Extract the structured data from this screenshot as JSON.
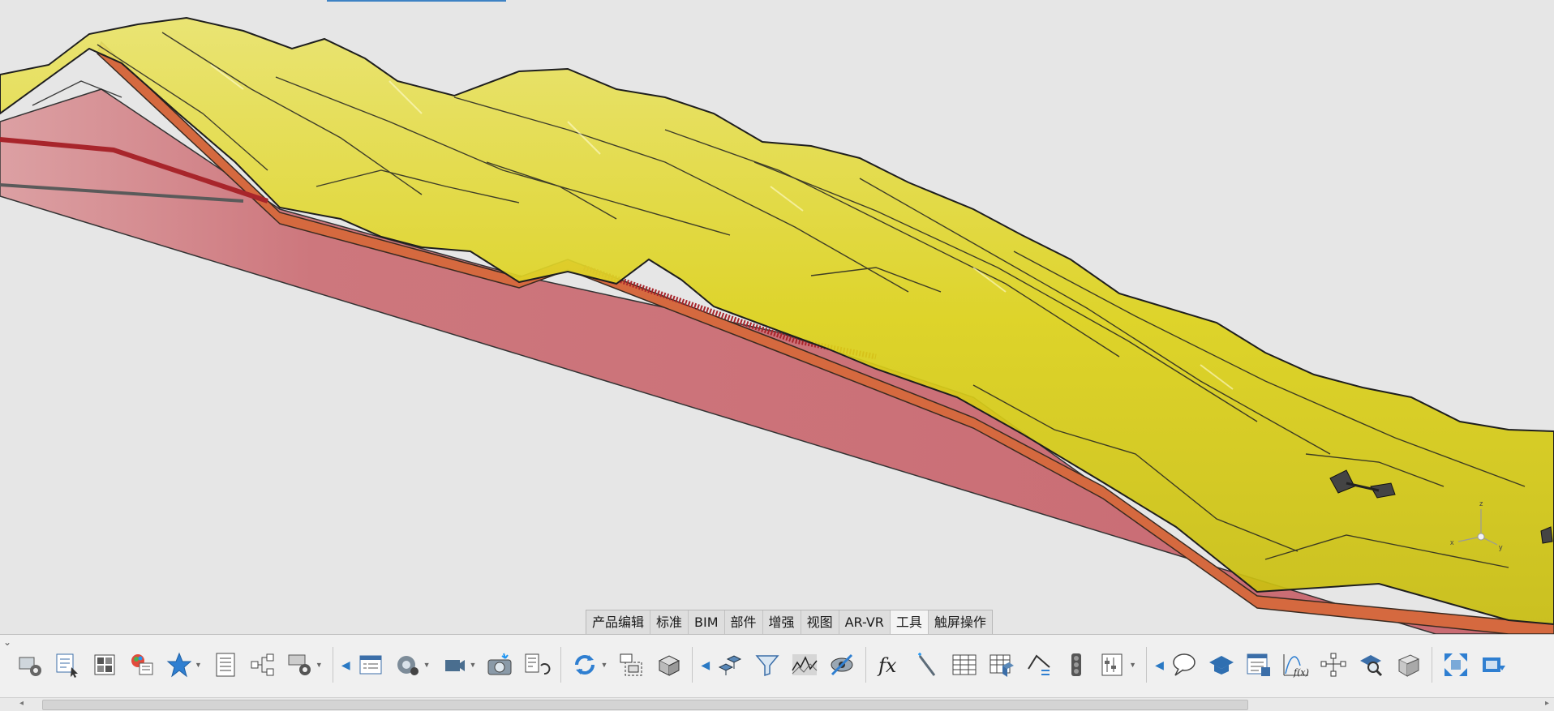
{
  "ribbon": {
    "tabs": [
      {
        "label": "产品编辑"
      },
      {
        "label": "标准"
      },
      {
        "label": "BIM"
      },
      {
        "label": "部件"
      },
      {
        "label": "增强"
      },
      {
        "label": "视图"
      },
      {
        "label": "AR-VR"
      },
      {
        "label": "工具",
        "active": true
      },
      {
        "label": "触屏操作"
      }
    ]
  },
  "compass": {
    "z": "z",
    "x": "x",
    "y": "y"
  },
  "toolbar": {
    "icons": [
      "command-settings-icon",
      "select-tool-icon",
      "layout-grid-icon",
      "material-render-icon",
      "favorites-star-icon",
      "list-report-icon",
      "tree-structure-icon",
      "options-icon",
      "properties-panel-icon",
      "render-settings-icon",
      "camera-icon",
      "capture-image-icon",
      "animation-icon",
      "refresh-icon",
      "selection-box-icon",
      "stack-objects-icon",
      "transform-icon",
      "filter-icon",
      "terrain-analysis-icon",
      "hide-show-icon",
      "formula-fx-icon",
      "magic-wand-icon",
      "table-icon",
      "database-icon",
      "measure-icon",
      "traffic-light-icon",
      "data-slider-icon",
      "comment-icon",
      "learning-icon",
      "data-panel-icon",
      "function-graph-icon",
      "network-icon",
      "inspect-icon",
      "solid-box-icon",
      "zoom-fit-icon",
      "toolbar-end-icon"
    ]
  },
  "colors": {
    "terrain": "#e0d60c",
    "terrain_dark": "#a89d0a",
    "section": "#cd727a",
    "strata_edge": "#d86a44",
    "background": "#e6e6e6",
    "accent": "#3d82c4"
  }
}
